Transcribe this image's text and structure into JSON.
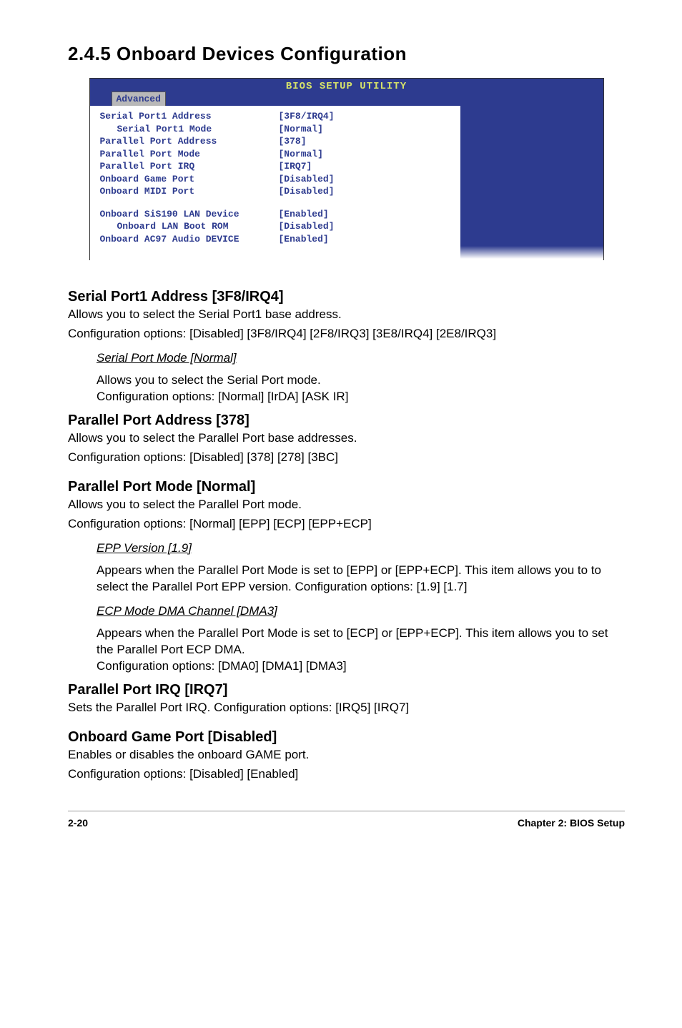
{
  "section_title": "2.4.5  Onboard Devices Configuration",
  "bios": {
    "utility_title": "BIOS SETUP UTILITY",
    "tab": "Advanced",
    "rows": [
      {
        "label": "Serial Port1 Address",
        "value": "[3F8/IRQ4]",
        "indent": false
      },
      {
        "label": "Serial Port1 Mode",
        "value": "[Normal]",
        "indent": true
      },
      {
        "label": "Parallel Port Address",
        "value": "[378]",
        "indent": false
      },
      {
        "label": "Parallel Port Mode",
        "value": "[Normal]",
        "indent": false
      },
      {
        "label": "Parallel Port IRQ",
        "value": "[IRQ7]",
        "indent": false
      },
      {
        "label": "Onboard Game Port",
        "value": "[Disabled]",
        "indent": false
      },
      {
        "label": "Onboard MIDI Port",
        "value": "[Disabled]",
        "indent": false
      }
    ],
    "rows2": [
      {
        "label": "Onboard SiS190 LAN Device",
        "value": "[Enabled]",
        "indent": false
      },
      {
        "label": "Onboard LAN Boot ROM",
        "value": "[Disabled]",
        "indent": true
      },
      {
        "label": "Onboard AC97 Audio DEVICE",
        "value": "[Enabled]",
        "indent": false
      }
    ]
  },
  "items": {
    "serial_port1": {
      "head": "Serial Port1 Address [3F8/IRQ4]",
      "line1": "Allows you to select the Serial Port1 base address.",
      "line2": "Configuration options: [Disabled] [3F8/IRQ4] [2F8/IRQ3] [3E8/IRQ4] [2E8/IRQ3]"
    },
    "serial_port_mode": {
      "head": "Serial Port Mode [Normal]",
      "line1": "Allows you to select the Serial Port mode.",
      "line2": "Configuration options: [Normal] [IrDA] [ASK IR]"
    },
    "parallel_addr": {
      "head": "Parallel Port Address [378]",
      "line1": "Allows you to select the Parallel Port base addresses.",
      "line2": "Configuration options: [Disabled] [378] [278] [3BC]"
    },
    "parallel_mode": {
      "head": "Parallel Port Mode [Normal]",
      "line1": "Allows you to select the Parallel Port mode.",
      "line2": "Configuration options: [Normal] [EPP] [ECP] [EPP+ECP]"
    },
    "epp_version": {
      "head": "EPP Version [1.9]",
      "line1": "Appears when the Parallel Port Mode is set to [EPP] or [EPP+ECP]. This item allows you to to select the Parallel Port EPP version. Configuration options: [1.9] [1.7]"
    },
    "ecp_dma": {
      "head": "ECP Mode DMA Channel [DMA3]",
      "line1": "Appears when the Parallel Port Mode is set to [ECP] or [EPP+ECP]. This item allows you to set the Parallel Port ECP DMA.",
      "line2": "Configuration options: [DMA0] [DMA1] [DMA3]"
    },
    "parallel_irq": {
      "head": "Parallel Port IRQ [IRQ7]",
      "line1": "Sets the Parallel Port IRQ. Configuration options: [IRQ5] [IRQ7]"
    },
    "game_port": {
      "head": "Onboard Game Port [Disabled]",
      "line1": "Enables or disables the onboard GAME port.",
      "line2": "Configuration options: [Disabled] [Enabled]"
    }
  },
  "footer": {
    "left": "2-20",
    "right": "Chapter 2: BIOS Setup"
  }
}
